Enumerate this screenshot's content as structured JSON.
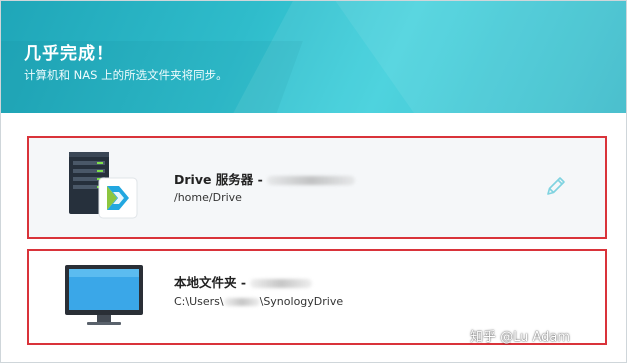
{
  "header": {
    "title": "几乎完成！",
    "subtitle": "计算机和 NAS 上的所选文件夹将同步。"
  },
  "server_card": {
    "name": "Drive 服务器 -",
    "path": "/home/Drive",
    "icon": "synology-drive-server-icon",
    "edit_icon": "pencil-icon"
  },
  "local_card": {
    "name": "本地文件夹 -",
    "path_prefix": "C:\\Users\\",
    "path_suffix": "\\SynologyDrive",
    "icon": "monitor-icon"
  },
  "watermark": "知乎 @Lu Adam",
  "colors": {
    "header": "#2fbccb",
    "highlight_border": "#d9333a",
    "edit_icon": "#7fd3e0",
    "monitor_screen": "#3aa7e8"
  }
}
